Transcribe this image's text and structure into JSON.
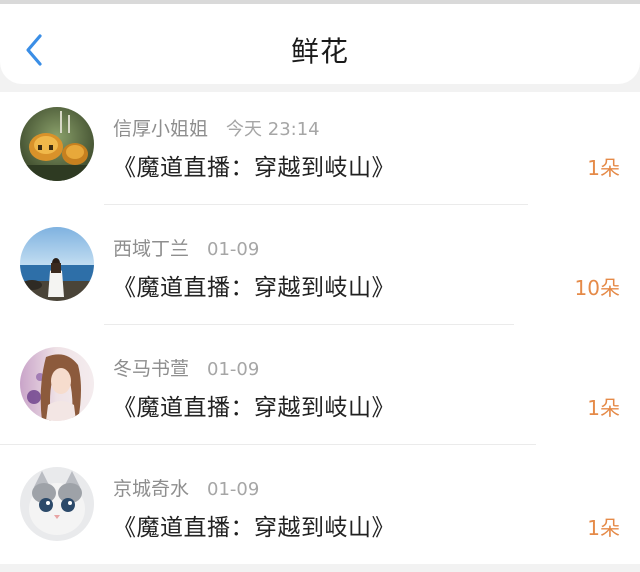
{
  "header": {
    "title": "鲜花",
    "back_icon": "chevron-left-icon",
    "accent_color": "#3a8ee6"
  },
  "items": [
    {
      "name": "信厚小姐姐",
      "time": "今天 23:14",
      "message": "《魔道直播：穿越到岐山》",
      "count": "1朵"
    },
    {
      "name": "西域丁兰",
      "time": "01-09",
      "message": "《魔道直播：穿越到岐山》",
      "count": "10朵"
    },
    {
      "name": "冬马书萱",
      "time": "01-09",
      "message": "《魔道直播：穿越到岐山》",
      "count": "1朵"
    },
    {
      "name": "京城奇水",
      "time": "01-09",
      "message": "《魔道直播：穿越到岐山》",
      "count": "1朵"
    }
  ],
  "colors": {
    "count": "#e58a48",
    "name": "#8e8e8e",
    "message": "#222222"
  }
}
